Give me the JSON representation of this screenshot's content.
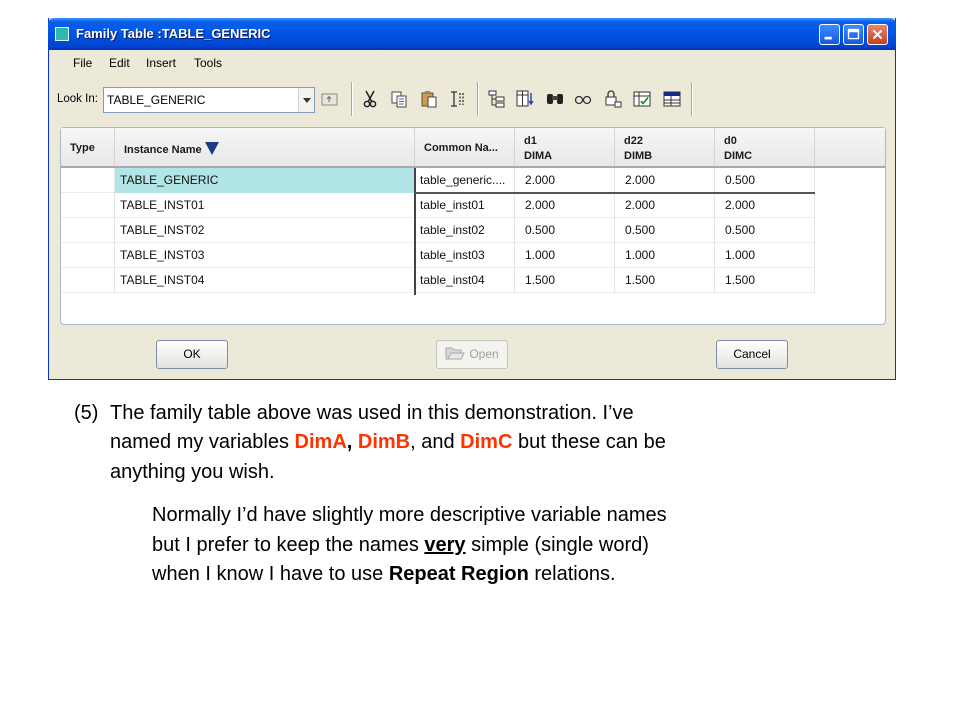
{
  "window": {
    "title": "Family Table :TABLE_GENERIC",
    "controls": {
      "minimize": "minimize-icon",
      "maximize": "maximize-icon",
      "close": "close-icon"
    }
  },
  "menu": [
    "File",
    "Edit",
    "Insert",
    "Tools"
  ],
  "toolbar": {
    "look_in_label": "Look In:",
    "look_in_value": "TABLE_GENERIC",
    "tools": [
      "up-folder-icon",
      "cut-icon",
      "copy-icon",
      "paste-icon",
      "insert-item-icon",
      "tree-icon",
      "add-column-icon",
      "find-icon",
      "verify-icon",
      "lock-icon",
      "edit-table-icon",
      "table-grid-icon"
    ]
  },
  "table": {
    "headers": [
      {
        "line1": "Type"
      },
      {
        "line1": "Instance Name",
        "sorted": true
      },
      {
        "line1": "Common Na..."
      },
      {
        "line1": "d1",
        "line2": "DIMA"
      },
      {
        "line1": "d22",
        "line2": "DIMB"
      },
      {
        "line1": "d0",
        "line2": "DIMC"
      }
    ],
    "rows": [
      {
        "type": "",
        "instance": "TABLE_GENERIC",
        "common": "table_generic....",
        "d1": "2.000",
        "d22": "2.000",
        "d0": "0.500",
        "selected": true
      },
      {
        "type": "",
        "instance": "TABLE_INST01",
        "common": "table_inst01",
        "d1": "2.000",
        "d22": "2.000",
        "d0": "2.000"
      },
      {
        "type": "",
        "instance": "TABLE_INST02",
        "common": "table_inst02",
        "d1": "0.500",
        "d22": "0.500",
        "d0": "0.500"
      },
      {
        "type": "",
        "instance": "TABLE_INST03",
        "common": "table_inst03",
        "d1": "1.000",
        "d22": "1.000",
        "d0": "1.000"
      },
      {
        "type": "",
        "instance": "TABLE_INST04",
        "common": "table_inst04",
        "d1": "1.500",
        "d22": "1.500",
        "d0": "1.500"
      }
    ]
  },
  "buttons": {
    "ok": "OK",
    "open": "Open",
    "cancel": "Cancel"
  },
  "slide": {
    "p1": {
      "num": "(5)",
      "t1": "The family table above was used in this demonstration. I’ve",
      "t2a": "named my variables ",
      "var_a": "DimA",
      "sep1": ", ",
      "var_b": "DimB",
      "sep2": ", and ",
      "var_c": "DimC",
      "t2b": " but these can be",
      "t3": "anything you wish."
    },
    "p2": {
      "t1": "Normally I’d have slightly more descriptive variable names",
      "t2a": "but I prefer to keep the names ",
      "emph": "very",
      "t2b": " simple (single word)",
      "t3a": "when I know I have to use ",
      "strong": "Repeat Region",
      "t3b": " relations."
    }
  },
  "colors": {
    "titlebar": "#0054e3",
    "selection": "#b2e6e6",
    "highlight_text": "#ff3300"
  }
}
